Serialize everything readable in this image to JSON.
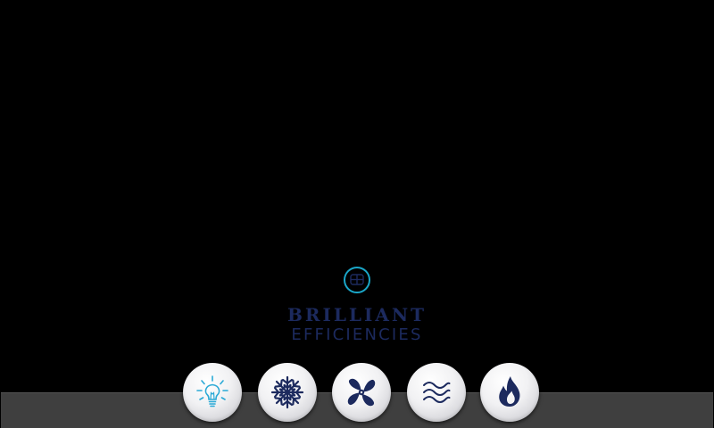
{
  "brand": {
    "line1": "BRILLIANT",
    "line2": "EFFICIENCIES",
    "text_color": "#1c2a5e",
    "mark_color": "#1aa6c8"
  },
  "mode_buttons": [
    {
      "icon": "lightbulb-icon",
      "color": "#2aa9d6"
    },
    {
      "icon": "snowflake-icon",
      "color": "#1c2a5e"
    },
    {
      "icon": "fan-icon",
      "color": "#1c2a5e"
    },
    {
      "icon": "waves-icon",
      "color": "#1c2a5e"
    },
    {
      "icon": "flame-icon",
      "color": "#1c2a5e"
    }
  ],
  "colors": {
    "background": "#000000",
    "bottom_bar": "#3f3f3f"
  }
}
